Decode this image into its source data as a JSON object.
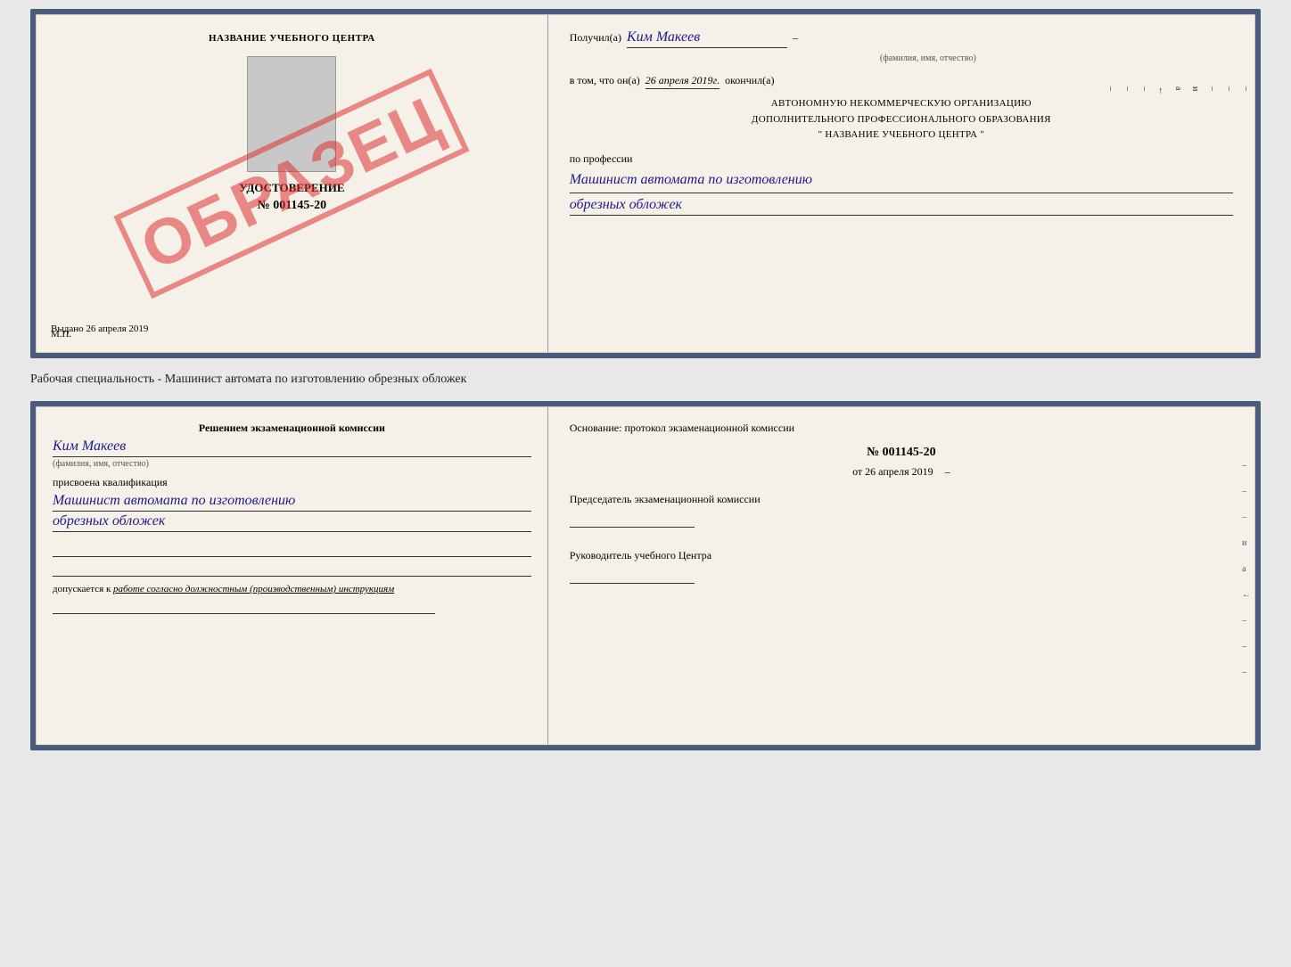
{
  "top_document": {
    "left": {
      "training_center": "НАЗВАНИЕ УЧЕБНОГО ЦЕНТРА",
      "certificate_type": "УДОСТОВЕРЕНИЕ",
      "certificate_number": "№ 001145-20",
      "issued_label": "Выдано",
      "issued_date": "26 апреля 2019",
      "mp_label": "М.П.",
      "stamp_text": "ОБРАЗЕЦ"
    },
    "right": {
      "recipient_prefix": "Получил(а)",
      "recipient_name": "Ким Макеев",
      "recipient_subtitle": "(фамилия, имя, отчество)",
      "vtom_prefix": "в том, что он(а)",
      "vtom_date": "26 апреля 2019г.",
      "vtom_suffix": "окончил(а)",
      "org_line1": "АВТОНОМНУЮ НЕКОММЕРЧЕСКУЮ ОРГАНИЗАЦИЮ",
      "org_line2": "ДОПОЛНИТЕЛЬНОГО ПРОФЕССИОНАЛЬНОГО ОБРАЗОВАНИЯ",
      "org_line3": "\"   НАЗВАНИЕ УЧЕБНОГО ЦЕНТРА   \"",
      "profession_label": "по профессии",
      "profession_line1": "Машинист автомата по изготовлению",
      "profession_line2": "обрезных обложек"
    }
  },
  "speciality_label": "Рабочая специальность - Машинист автомата по изготовлению обрезных обложек",
  "bottom_document": {
    "left": {
      "decision_title": "Решением экзаменационной комиссии",
      "person_name": "Ким Макеев",
      "fio_subtitle": "(фамилия, имя, отчество)",
      "qualification_prefix": "присвоена квалификация",
      "qualification_line1": "Машинист автомата по изготовлению",
      "qualification_line2": "обрезных обложек",
      "admission_prefix": "допускается к",
      "admission_text": "работе согласно должностным (производственным) инструкциям"
    },
    "right": {
      "basis_title": "Основание: протокол экзаменационной комиссии",
      "protocol_number": "№ 001145-20",
      "protocol_date_prefix": "от",
      "protocol_date": "26 апреля 2019",
      "chairman_title": "Председатель экзаменационной комиссии",
      "director_title": "Руководитель учебного Центра"
    }
  },
  "margin_marks": {
    "top_right": [
      "–",
      "–",
      "–",
      "и",
      "а",
      "←",
      "–",
      "–",
      "–",
      "–"
    ],
    "bottom_right": [
      "–",
      "–",
      "–",
      "и",
      "а",
      "←",
      "–",
      "–",
      "–",
      "–"
    ]
  }
}
